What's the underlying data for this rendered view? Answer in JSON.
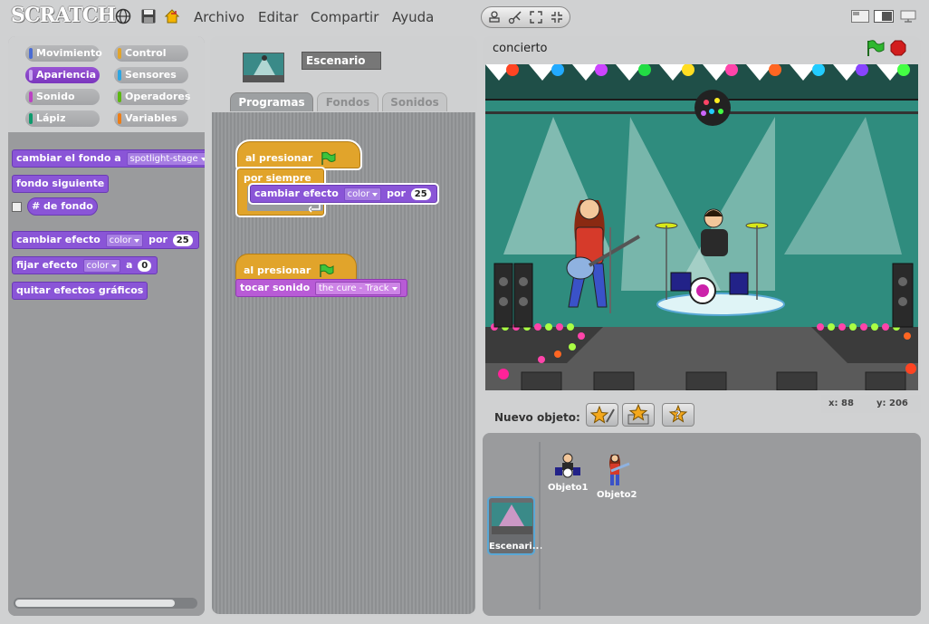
{
  "app": {
    "logo_text": "SCRATCH"
  },
  "menu": {
    "items": [
      "Archivo",
      "Editar",
      "Compartir",
      "Ayuda"
    ]
  },
  "palette": {
    "categories": [
      {
        "label": "Movimiento",
        "color": "#4a6cd4"
      },
      {
        "label": "Control",
        "color": "#e1a42b"
      },
      {
        "label": "Apariencia",
        "color": "#8a55d7"
      },
      {
        "label": "Sensores",
        "color": "#2ca5e2"
      },
      {
        "label": "Sonido",
        "color": "#bb42c3"
      },
      {
        "label": "Operadores",
        "color": "#5cb712"
      },
      {
        "label": "Lápiz",
        "color": "#0e9a6c"
      },
      {
        "label": "Variables",
        "color": "#ee7d16"
      }
    ],
    "active_category": "Apariencia",
    "blocks": {
      "change_backdrop": {
        "text": "cambiar el fondo a",
        "value": "spotlight-stage"
      },
      "next_backdrop": "fondo siguiente",
      "backdrop_number": "# de fondo",
      "change_effect": {
        "text": "cambiar efecto",
        "effect": "color",
        "by": "por",
        "amount": "25"
      },
      "set_effect": {
        "text": "fijar efecto",
        "effect": "color",
        "to": "a",
        "amount": "0"
      },
      "clear_effects": "quitar efectos gráficos"
    }
  },
  "center": {
    "object_name": "Escenario",
    "tabs": [
      "Programas",
      "Fondos",
      "Sonidos"
    ],
    "active_tab": "Programas",
    "script1": {
      "hat": "al presionar",
      "loop": "por siempre",
      "inner": {
        "text": "cambiar efecto",
        "effect": "color",
        "by": "por",
        "amount": "25"
      }
    },
    "script2": {
      "hat": "al presionar",
      "sound": {
        "text": "tocar sonido",
        "value": "the cure - Track"
      }
    }
  },
  "stage": {
    "title": "concierto",
    "colors": {
      "go": "#2fb82f",
      "stop": "#d21d1d"
    }
  },
  "coords": {
    "x_label": "x:",
    "x": "88",
    "y_label": "y:",
    "y": "206"
  },
  "sprites": {
    "new_object_label": "Nuevo objeto:",
    "stage_label": "Escenari...",
    "items": [
      "Objeto1",
      "Objeto2"
    ]
  }
}
